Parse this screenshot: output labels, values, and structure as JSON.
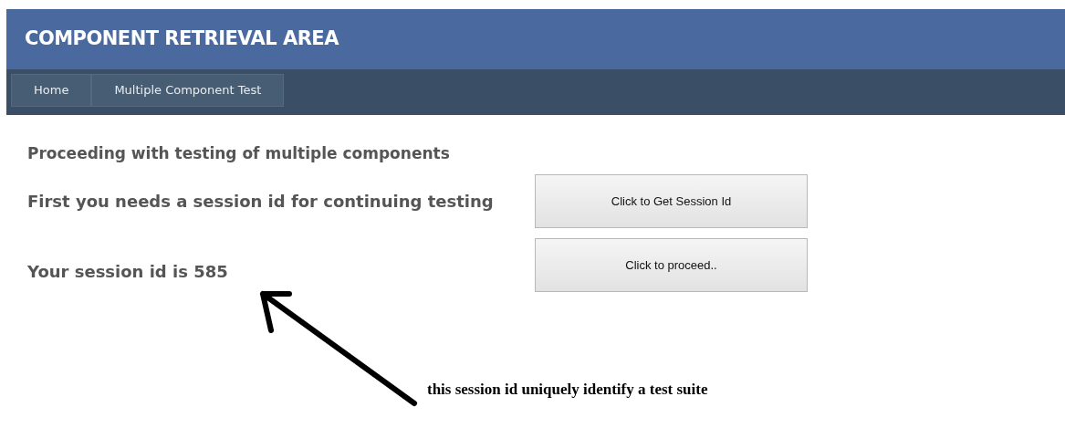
{
  "header": {
    "title": "COMPONENT RETRIEVAL AREA"
  },
  "nav": [
    {
      "label": "Home"
    },
    {
      "label": "Multiple Component Test"
    }
  ],
  "content": {
    "heading": "Proceeding with testing of multiple components",
    "rows": [
      {
        "text": "First you needs a session id for continuing testing",
        "button": "Click to Get Session Id"
      },
      {
        "text": "Your session id is 585",
        "button": "Click to proceed.."
      }
    ]
  },
  "annotation": {
    "text": "this session id uniquely identify a test suite"
  }
}
